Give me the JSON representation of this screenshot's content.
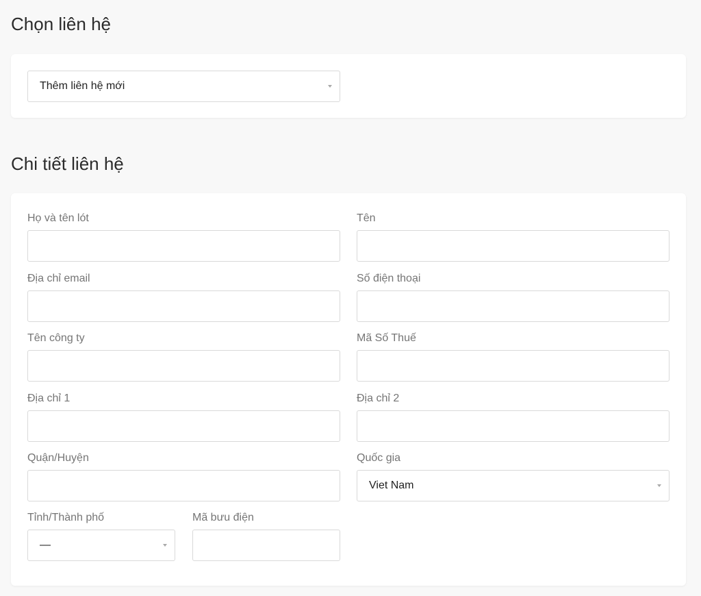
{
  "choose_section": {
    "title": "Chọn liên hệ",
    "contact_select": {
      "value": "Thêm liên hệ mới"
    }
  },
  "details_section": {
    "title": "Chi tiết liên hệ",
    "fields": {
      "first_middle_name": {
        "label": "Họ và tên lót",
        "value": ""
      },
      "last_name": {
        "label": "Tên",
        "value": ""
      },
      "email": {
        "label": "Địa chỉ email",
        "value": ""
      },
      "phone": {
        "label": "Số điện thoại",
        "value": ""
      },
      "company": {
        "label": "Tên công ty",
        "value": ""
      },
      "tax_code": {
        "label": "Mã Số Thuế",
        "value": ""
      },
      "address1": {
        "label": "Địa chỉ 1",
        "value": ""
      },
      "address2": {
        "label": "Địa chỉ 2",
        "value": ""
      },
      "district": {
        "label": "Quận/Huyện",
        "value": ""
      },
      "country": {
        "label": "Quốc gia",
        "value": "Viet Nam"
      },
      "province": {
        "label": "Tỉnh/Thành phố",
        "value": "—"
      },
      "postal_code": {
        "label": "Mã bưu điện",
        "value": ""
      }
    }
  }
}
